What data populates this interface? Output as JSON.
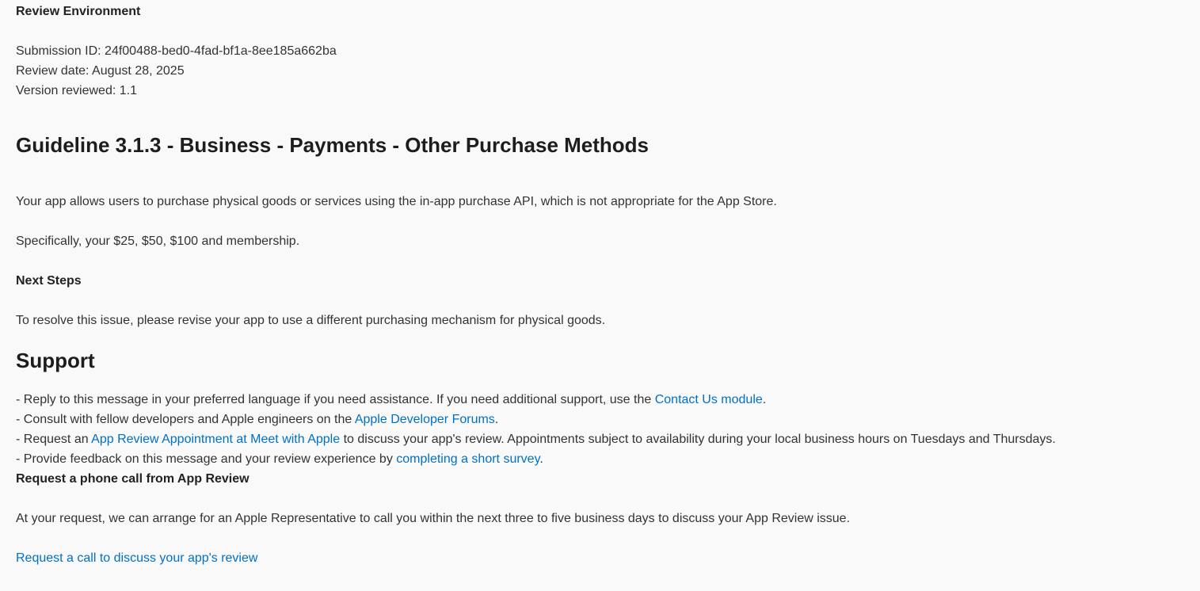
{
  "review_env": {
    "heading": "Review Environment",
    "submission_id": "Submission ID: 24f00488-bed0-4fad-bf1a-8ee185a662ba",
    "review_date": "Review date: August 28, 2025",
    "version": "Version reviewed: 1.1"
  },
  "guideline": {
    "title": "Guideline 3.1.3 - Business - Payments - Other Purchase Methods",
    "description": "Your app allows users to purchase physical goods or services using the in-app purchase API, which is not appropriate for the App Store.",
    "specifics": "Specifically, your $25, $50, $100 and membership.",
    "next_steps_heading": "Next Steps",
    "next_steps_text": "To resolve this issue, please revise your app to use a different purchasing mechanism for physical goods."
  },
  "support": {
    "heading": "Support",
    "item1_pre": "- Reply to this message in your preferred language if you need assistance. If you need additional support, use the ",
    "item1_link": "Contact Us module",
    "item1_post": ".",
    "item2_pre": "- Consult with fellow developers and Apple engineers on the ",
    "item2_link": "Apple Developer Forums",
    "item2_post": ".",
    "item3_pre": "- Request an ",
    "item3_link": "App Review Appointment at Meet with Apple",
    "item3_post": " to discuss your app's review. Appointments subject to availability during your local business hours on Tuesdays and Thursdays.",
    "item4_pre": "- Provide feedback on this message and your review experience by ",
    "item4_link": "completing a short survey",
    "item4_post": "."
  },
  "phone_call": {
    "heading": "Request a phone call from App Review",
    "text": "At your request, we can arrange for an Apple Representative to call you within the next three to five business days to discuss your App Review issue.",
    "link": "Request a call to discuss your app's review"
  }
}
